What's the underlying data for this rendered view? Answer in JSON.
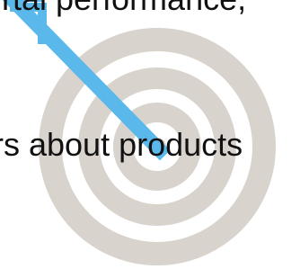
{
  "slide": {
    "top_text": "rtal performance,",
    "middle_text": "rs about products"
  },
  "icons": {
    "target": "target-icon",
    "arrow": "arrow-icon"
  },
  "colors": {
    "ring_outer": "#d8d3cc",
    "ring_inner": "#d7d2cb",
    "arrow": "#5ab8ea",
    "text": "#111111",
    "background": "#ffffff"
  }
}
